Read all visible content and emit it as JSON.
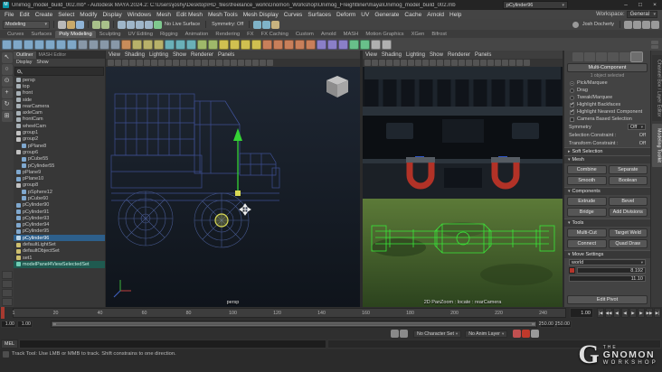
{
  "window": {
    "app_icon": "M",
    "title": "Unimog_model_build_002.mb* - Autodesk MAYA 2024.2: C:\\Users\\joshy\\Desktop\\HD_files\\freelance_work\\Gnomon_Workshop\\Unimog_Freightliner\\maya\\Unimog_model_build_002.mb",
    "object_field": "pCylinder96",
    "minimize": "–",
    "maximize": "□",
    "close": "×"
  },
  "menu": {
    "items": [
      "File",
      "Edit",
      "Create",
      "Select",
      "Modify",
      "Display",
      "Windows",
      "Mesh",
      "Edit Mesh",
      "Mesh Tools",
      "Mesh Display",
      "Curves",
      "Surfaces",
      "Deform",
      "UV",
      "Generate",
      "Cache",
      "Arnold",
      "Help"
    ],
    "workspace_label": "Workspace:",
    "workspace_value": "General"
  },
  "status": {
    "menu_set": "Modeling",
    "file_icons": [
      {
        "name": "new-scene-icon",
        "c": "#b9b9b9"
      },
      {
        "name": "open-scene-icon",
        "c": "#c9a96a"
      },
      {
        "name": "save-scene-icon",
        "c": "#8fb3d6"
      }
    ],
    "history_icons": [
      {
        "name": "undo-icon",
        "c": "#a8c08a"
      },
      {
        "name": "redo-icon",
        "c": "#a8c08a"
      }
    ],
    "snap_icons": [
      {
        "name": "snap-to-grid-icon",
        "c": "#9fb6c9"
      },
      {
        "name": "snap-to-curve-icon",
        "c": "#9fb6c9"
      },
      {
        "name": "snap-to-point-icon",
        "c": "#9fb6c9"
      },
      {
        "name": "snap-to-plane-icon",
        "c": "#9fb6c9"
      },
      {
        "name": "make-live-icon",
        "c": "#7fc98f"
      }
    ],
    "no_live_surface": "No Live Surface",
    "symmetry": "Symmetry: Off",
    "render_icons": [
      {
        "name": "render-frame-icon",
        "c": "#7fb3c8"
      },
      {
        "name": "ipr-render-icon",
        "c": "#7fb3c8"
      },
      {
        "name": "render-settings-icon",
        "c": "#c8b37f"
      }
    ],
    "account": "Josh Docherty",
    "panel_toggle_icons": [
      {
        "name": "attribute-editor-toggle-icon",
        "c": "#9a9a9a"
      },
      {
        "name": "tool-settings-toggle-icon",
        "c": "#9a9a9a"
      },
      {
        "name": "channel-box-toggle-icon",
        "c": "#9a9a9a"
      },
      {
        "name": "modeling-toolkit-toggle-icon",
        "c": "#9a9a9a"
      }
    ]
  },
  "shelf": {
    "tabs": [
      {
        "label": "Curves"
      },
      {
        "label": "Surfaces"
      },
      {
        "label": "Poly Modeling",
        "cls": "active"
      },
      {
        "label": "Sculpting"
      },
      {
        "label": "UV Editing"
      },
      {
        "label": "Rigging"
      },
      {
        "label": "Animation"
      },
      {
        "label": "Rendering"
      },
      {
        "label": "FX"
      },
      {
        "label": "FX Caching"
      },
      {
        "label": "Custom"
      },
      {
        "label": "Arnold"
      },
      {
        "label": "MASH"
      },
      {
        "label": "Motion Graphics"
      },
      {
        "label": "XGen"
      },
      {
        "label": "Bifrost"
      }
    ],
    "icons": [
      {
        "name": "poly-sphere-icon",
        "c": "#7fa8c8"
      },
      {
        "name": "poly-cube-icon",
        "c": "#7fa8c8"
      },
      {
        "name": "poly-cylinder-icon",
        "c": "#7fa8c8"
      },
      {
        "name": "poly-cone-icon",
        "c": "#7fa8c8"
      },
      {
        "name": "poly-torus-icon",
        "c": "#7fa8c8"
      },
      {
        "name": "poly-plane-icon",
        "c": "#7fa8c8"
      },
      {
        "name": "poly-disc-icon",
        "c": "#7fa8c8"
      },
      {
        "name": "poly-gear-icon",
        "c": "#8898a8"
      },
      {
        "name": "poly-soccer-ball-icon",
        "c": "#8898a8"
      },
      {
        "name": "poly-platonic-icon",
        "c": "#8898a8"
      },
      {
        "name": "poly-super-ellipse-icon",
        "c": "#8898a8"
      },
      {
        "name": "sculpt-mesh-icon",
        "c": "#c88c5a"
      },
      {
        "name": "combine-icon",
        "c": "#b8b16a"
      },
      {
        "name": "separate-icon",
        "c": "#b8b16a"
      },
      {
        "name": "extract-icon",
        "c": "#b8b16a"
      },
      {
        "name": "boolean-union-icon",
        "c": "#6ab0b8"
      },
      {
        "name": "boolean-difference-icon",
        "c": "#6ab0b8"
      },
      {
        "name": "boolean-intersection-icon",
        "c": "#6ab0b8"
      },
      {
        "name": "smooth-icon",
        "c": "#9fb86a"
      },
      {
        "name": "reduce-icon",
        "c": "#9fb86a"
      },
      {
        "name": "multi-cut-icon",
        "c": "#d0c050"
      },
      {
        "name": "connect-icon",
        "c": "#d0c050"
      },
      {
        "name": "insert-edge-loop-icon",
        "c": "#d0c050"
      },
      {
        "name": "offset-edge-loop-icon",
        "c": "#d0c050"
      },
      {
        "name": "extrude-icon",
        "c": "#c87f5a"
      },
      {
        "name": "bevel-icon",
        "c": "#c87f5a"
      },
      {
        "name": "bridge-icon",
        "c": "#c87f5a"
      },
      {
        "name": "fill-hole-icon",
        "c": "#c87f5a"
      },
      {
        "name": "append-to-poly-icon",
        "c": "#c87f5a"
      },
      {
        "name": "mirror-icon",
        "c": "#8a7fc8"
      },
      {
        "name": "symmetrize-icon",
        "c": "#8a7fc8"
      },
      {
        "name": "average-vertices-icon",
        "c": "#8a7fc8"
      },
      {
        "name": "quad-draw-icon",
        "c": "#68c08a"
      },
      {
        "name": "target-weld-icon",
        "c": "#68c08a"
      },
      {
        "name": "center-pivot-icon",
        "c": "#b0b0b0"
      },
      {
        "name": "delete-history-icon",
        "c": "#b0b0b0"
      }
    ]
  },
  "toolbox": {
    "tools": [
      {
        "name": "select-tool-icon",
        "g": "↖"
      },
      {
        "name": "lasso-tool-icon",
        "g": "○"
      },
      {
        "name": "paint-select-tool-icon",
        "g": "⊙"
      },
      {
        "name": "move-tool-icon",
        "g": "+"
      },
      {
        "name": "rotate-tool-icon",
        "g": "↻"
      },
      {
        "name": "scale-tool-icon",
        "g": "⊞"
      }
    ],
    "layouts": [
      {
        "name": "single-pane-layout-icon"
      },
      {
        "name": "four-pane-layout-icon"
      },
      {
        "name": "persp-outliner-layout-icon"
      },
      {
        "name": "persp-uv-layout-icon"
      }
    ]
  },
  "outliner": {
    "tabs": [
      {
        "label": "Outliner",
        "cls": "active"
      },
      {
        "label": "MASH Editor"
      }
    ],
    "menus": [
      "Display",
      "Show"
    ],
    "items": [
      {
        "label": "persp",
        "icon": "camera-icon",
        "c": "#a7b0b6"
      },
      {
        "label": "top",
        "icon": "camera-icon",
        "c": "#a7b0b6"
      },
      {
        "label": "front",
        "icon": "camera-icon",
        "c": "#a7b0b6"
      },
      {
        "label": "side",
        "icon": "camera-icon",
        "c": "#a7b0b6"
      },
      {
        "label": "rearCamera",
        "icon": "camera-icon",
        "c": "#a7b0b6"
      },
      {
        "label": "axleCam",
        "icon": "camera-icon",
        "c": "#a7b0b6"
      },
      {
        "label": "frontCam",
        "icon": "camera-icon",
        "c": "#a7b0b6"
      },
      {
        "label": "wheelCam",
        "icon": "camera-icon",
        "c": "#a7b0b6"
      },
      {
        "label": "group1",
        "icon": "group-icon",
        "c": "#c2c2c2"
      },
      {
        "label": "group2",
        "icon": "group-icon",
        "c": "#c2c2c2"
      },
      {
        "label": "pPlane8",
        "icon": "mesh-icon",
        "c": "#7fa8cf",
        "ind": 1
      },
      {
        "label": "group6",
        "icon": "group-icon",
        "c": "#c2c2c2"
      },
      {
        "label": "pCube55",
        "icon": "mesh-icon",
        "c": "#7fa8cf",
        "ind": 1
      },
      {
        "label": "pCylinder55",
        "icon": "mesh-icon",
        "c": "#7fa8cf",
        "ind": 1
      },
      {
        "label": "pPlane9",
        "icon": "mesh-icon",
        "c": "#7fa8cf"
      },
      {
        "label": "pPlane10",
        "icon": "mesh-icon",
        "c": "#7fa8cf"
      },
      {
        "label": "group8",
        "icon": "group-icon",
        "c": "#c2c2c2"
      },
      {
        "label": "pSphere12",
        "icon": "mesh-icon",
        "c": "#7fa8cf",
        "ind": 1
      },
      {
        "label": "pCube60",
        "icon": "mesh-icon",
        "c": "#7fa8cf",
        "ind": 1
      },
      {
        "label": "pCylinder90",
        "icon": "mesh-icon",
        "c": "#7fa8cf"
      },
      {
        "label": "pCylinder91",
        "icon": "mesh-icon",
        "c": "#7fa8cf"
      },
      {
        "label": "pCylinder93",
        "icon": "mesh-icon",
        "c": "#7fa8cf"
      },
      {
        "label": "pCylinder94",
        "icon": "mesh-icon",
        "c": "#7fa8cf"
      },
      {
        "label": "pCylinder95",
        "icon": "mesh-icon",
        "c": "#7fa8cf"
      },
      {
        "label": "pCylinder96",
        "icon": "mesh-icon",
        "c": "#bcd6ea",
        "cls": "sel"
      },
      {
        "label": "defaultLightSet",
        "icon": "set-icon",
        "c": "#cdbf6e"
      },
      {
        "label": "defaultObjectSet",
        "icon": "set-icon",
        "c": "#cdbf6e"
      },
      {
        "label": "set1",
        "icon": "set-icon",
        "c": "#cdbf6e"
      },
      {
        "label": "modelPanel4ViewSelectedSet",
        "icon": "set-icon",
        "c": "#6ecdb4",
        "cls": "viewset"
      }
    ]
  },
  "viewports": {
    "menu": [
      "View",
      "Shading",
      "Lighting",
      "Show",
      "Renderer",
      "Panels"
    ],
    "toolbar_icons": [
      {
        "name": "select-camera-icon"
      },
      {
        "name": "lock-camera-icon"
      },
      {
        "name": "camera-attributes-icon"
      },
      {
        "name": "bookmarks-icon"
      },
      {
        "name": "image-plane-icon"
      },
      {
        "name": "2d-pan-zoom-icon"
      },
      {
        "name": "grease-pencil-icon"
      },
      {
        "name": "grid-display-icon"
      },
      {
        "name": "film-gate-icon"
      },
      {
        "name": "resolution-gate-icon"
      },
      {
        "name": "gate-mask-icon"
      },
      {
        "name": "field-chart-icon"
      },
      {
        "name": "safe-action-icon"
      },
      {
        "name": "safe-title-icon"
      },
      {
        "name": "frame-all-icon"
      },
      {
        "name": "frame-selection-icon"
      },
      {
        "name": "default-lighting-icon"
      },
      {
        "name": "shadows-icon"
      },
      {
        "name": "ambient-occlusion-icon"
      },
      {
        "name": "anti-aliasing-icon"
      },
      {
        "name": "isolate-select-icon"
      },
      {
        "name": "x-ray-icon"
      },
      {
        "name": "wireframe-on-shaded-icon"
      }
    ],
    "left_label": "persp",
    "right_label": "2D PanZoom : locate : rearCamera"
  },
  "toolkit": {
    "mode_icons": [
      {
        "name": "object-mode-icon"
      },
      {
        "name": "vertex-mode-icon"
      },
      {
        "name": "edge-mode-icon"
      },
      {
        "name": "face-mode-icon"
      },
      {
        "name": "uv-mode-icon"
      },
      {
        "name": "multi-component-mode-icon",
        "cls": "active"
      }
    ],
    "title": "Multi-Component",
    "info": "1 object selected",
    "options": [
      {
        "label": "Pick/Marquee",
        "cls": "radio on"
      },
      {
        "label": "Drag",
        "cls": "radio"
      },
      {
        "label": "Tweak/Marquee",
        "cls": "radio"
      },
      {
        "label": "Highlight Backfaces",
        "cls": "check on"
      },
      {
        "label": "Highlight Nearest Component",
        "cls": "check on"
      },
      {
        "label": "Camera Based Selection",
        "cls": "check"
      }
    ],
    "symmetry_label": "Symmetry",
    "symmetry_value": "Off",
    "selection_constraint_label": "Selection Constraint :",
    "selection_constraint_value": "Off",
    "transform_constraint_label": "Transform Constraint :",
    "transform_constraint_value": "Off",
    "soft_selection_title": "Soft Selection",
    "mesh_title": "Mesh",
    "mesh_buttons": [
      "Combine",
      "Separate",
      "Smooth",
      "Boolean"
    ],
    "components_title": "Components",
    "components_buttons": [
      "Extrude",
      "Bevel",
      "Bridge",
      "Add Divisions"
    ],
    "tools_title": "Tools",
    "tools_buttons": [
      "Multi-Cut",
      "Target Weld",
      "Connect",
      "Quad Draw"
    ],
    "move_title": "Move Settings",
    "move_axis_value": "world",
    "move_value1": "8.192",
    "move_value2": "11.10",
    "edit_pivot": "Edit Pivot"
  },
  "right_strip": {
    "icons": [
      {
        "name": "attribute-editor-icon"
      },
      {
        "name": "tool-settings-icon"
      },
      {
        "name": "channel-box-icon"
      }
    ],
    "tabs": [
      {
        "label": "Channel Box / Layer Editor"
      },
      {
        "label": "Modeling Toolkit",
        "cls": "active"
      }
    ]
  },
  "timeline": {
    "ticks": [
      {
        "v": 1,
        "label": "1"
      },
      {
        "v": 20,
        "label": "20"
      },
      {
        "v": 40,
        "label": "40"
      },
      {
        "v": 60,
        "label": "60"
      },
      {
        "v": 80,
        "label": "80"
      },
      {
        "v": 100,
        "label": "100"
      },
      {
        "v": 120,
        "label": "120"
      },
      {
        "v": 140,
        "label": "140"
      },
      {
        "v": 160,
        "label": "160"
      },
      {
        "v": 180,
        "label": "180"
      },
      {
        "v": 200,
        "label": "200"
      },
      {
        "v": 220,
        "label": "220"
      },
      {
        "v": 240,
        "label": "240"
      }
    ],
    "current": "1.00",
    "playback": [
      {
        "name": "go-to-start-button",
        "g": "|◀"
      },
      {
        "name": "step-back-frame-button",
        "g": "◀◀"
      },
      {
        "name": "step-back-key-button",
        "g": "◀"
      },
      {
        "name": "play-backwards-button",
        "g": "◀"
      },
      {
        "name": "play-forward-button",
        "g": "▶"
      },
      {
        "name": "step-forward-key-button",
        "g": "▶"
      },
      {
        "name": "step-forward-frame-button",
        "g": "▶▶"
      },
      {
        "name": "go-to-end-button",
        "g": "▶|"
      }
    ]
  },
  "range": {
    "start_outer": "1.00",
    "start_inner": "1.00",
    "end_inner": "250.00",
    "end_outer": "250.00"
  },
  "anim": {
    "pre_icons": [
      {
        "name": "playback-options-icon",
        "c": "#8a8a8a"
      },
      {
        "name": "character-set-icon",
        "c": "#8a8a8a"
      }
    ],
    "character_set": "No Character Set",
    "anim_layer": "No Anim Layer",
    "post_icons": [
      {
        "name": "set-key-icon",
        "c": "#c05050"
      },
      {
        "name": "auto-key-icon",
        "c": "#c0392b"
      },
      {
        "name": "anim-preferences-icon",
        "c": "#9a9a9a"
      }
    ]
  },
  "command": {
    "label": "MEL"
  },
  "help": {
    "text": "Track Tool: Use LMB or MMB to track. Shift constrains to one direction."
  },
  "watermark": {
    "g": "G",
    "line1": "THE",
    "line2": "GNOMON",
    "line3": "WORKSHOP"
  },
  "colors": {
    "selection_blue": "#2d5f8b",
    "wireframe_blue": "#3e4f92",
    "manipulator_green": "#35d435",
    "highlight_yellow": "#d9d955",
    "shackle_red": "#b23227",
    "viewset_teal": "#1f5a50"
  }
}
